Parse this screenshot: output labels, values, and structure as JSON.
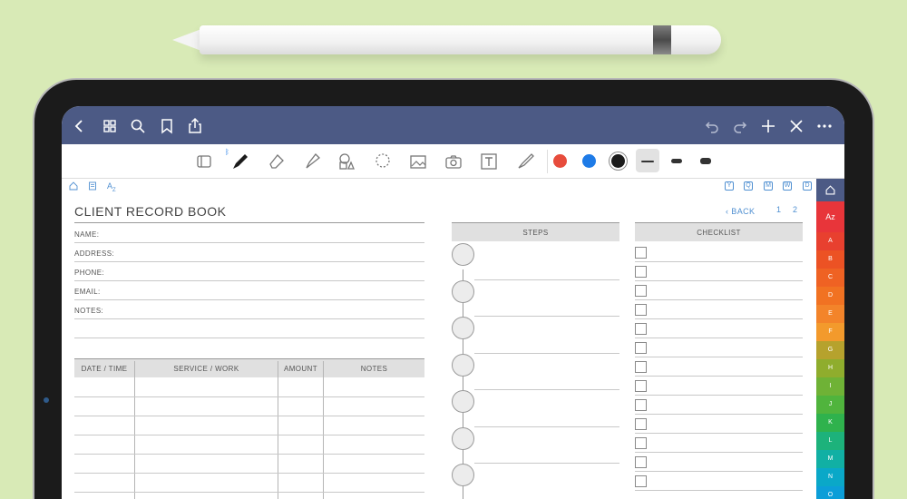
{
  "topbar": {
    "icons": [
      "back-icon",
      "grid-icon",
      "search-icon",
      "bookmark-icon",
      "share-icon",
      "undo-icon",
      "redo-icon",
      "plus-icon",
      "close-icon",
      "more-icon"
    ]
  },
  "toolbar": {
    "tools": [
      "document-tool-icon",
      "pen-tool-icon",
      "eraser-tool-icon",
      "highlighter-tool-icon",
      "shapes-tool-icon",
      "lasso-tool-icon",
      "image-tool-icon",
      "camera-tool-icon",
      "text-tool-icon",
      "brush-tool-icon"
    ],
    "colors": [
      "#e74c3c",
      "#1e7be7",
      "#1b1b1b"
    ]
  },
  "page": {
    "top_icons": [
      "home-icon",
      "notebook-icon",
      "az-icon"
    ],
    "right_icons": [
      "Y",
      "Q",
      "M",
      "W",
      "D"
    ],
    "title": "CLIENT RECORD BOOK",
    "back": "‹ BACK",
    "pages": [
      "1",
      "2"
    ],
    "fields": [
      "NAME:",
      "ADDRESS:",
      "PHONE:",
      "EMAIL:",
      "NOTES:"
    ],
    "table_headers": [
      "DATE / TIME",
      "SERVICE / WORK",
      "AMOUNT",
      "NOTES"
    ],
    "steps_header": "STEPS",
    "checklist_header": "CHECKLIST"
  },
  "side_tabs": {
    "home": "home-icon",
    "az": "Az",
    "letters": [
      "A",
      "B",
      "C",
      "D",
      "E",
      "F",
      "G",
      "H",
      "I",
      "J",
      "K",
      "L",
      "M",
      "N",
      "O"
    ]
  }
}
